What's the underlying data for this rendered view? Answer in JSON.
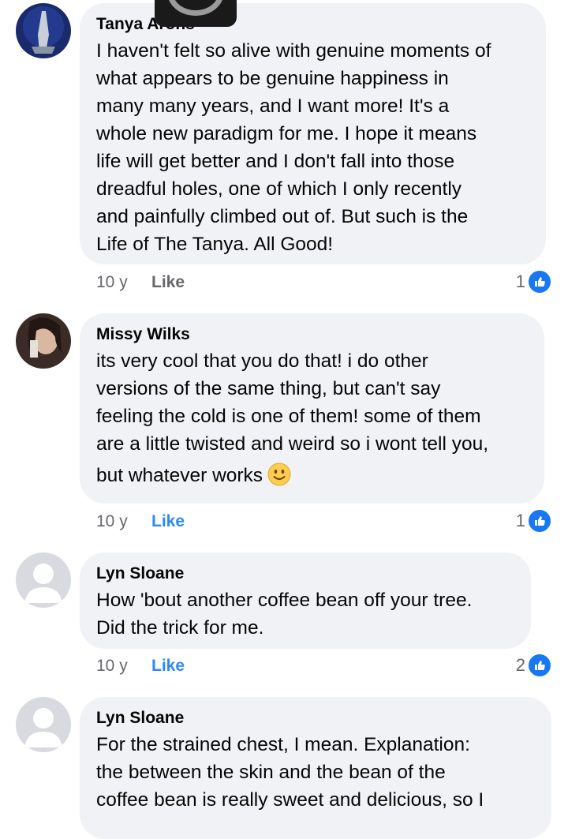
{
  "comments": [
    {
      "author": "Tanya Arons",
      "lines": [
        "I haven't felt so alive with genuine moments of",
        "what appears to be genuine happiness in",
        "many many years, and I want more!  It's a",
        "whole new paradigm for me.  I hope it means",
        "life will get better and I don't fall into those",
        "dreadful holes, one of which I only recently",
        "and painfully climbed out of.  But such is the",
        "Life of The Tanya.  All Good!"
      ],
      "time": "10 y",
      "like_label": "Like",
      "reactions": "1"
    },
    {
      "author": "Missy Wilks",
      "lines": [
        "its very cool that you do that! i do other",
        "versions of the same thing, but can't say",
        "feeling the cold is one of them! some of them",
        "are a little twisted and weird so i wont tell you,",
        "but whatever works"
      ],
      "time": "10 y",
      "like_label": "Like",
      "reactions": "1"
    },
    {
      "author": "Lyn Sloane",
      "lines": [
        "How 'bout another coffee bean off your tree.",
        "Did the trick for me."
      ],
      "time": "10 y",
      "like_label": "Like",
      "reactions": "2"
    },
    {
      "author": "Lyn Sloane",
      "lines": [
        "For the strained chest, I mean.  Explanation:",
        "the between the skin and the bean of the",
        "coffee bean is really sweet and delicious, so  I"
      ]
    }
  ],
  "icons": {
    "reaction": "thumbs-up-icon",
    "emoji": "slightly-smiling-face-icon",
    "default_avatar": "default-avatar-icon"
  },
  "colors": {
    "bubble": "#f0f2f5",
    "like_active": "#2d88ff",
    "meta": "#65676b",
    "reaction": "#1877f2"
  }
}
